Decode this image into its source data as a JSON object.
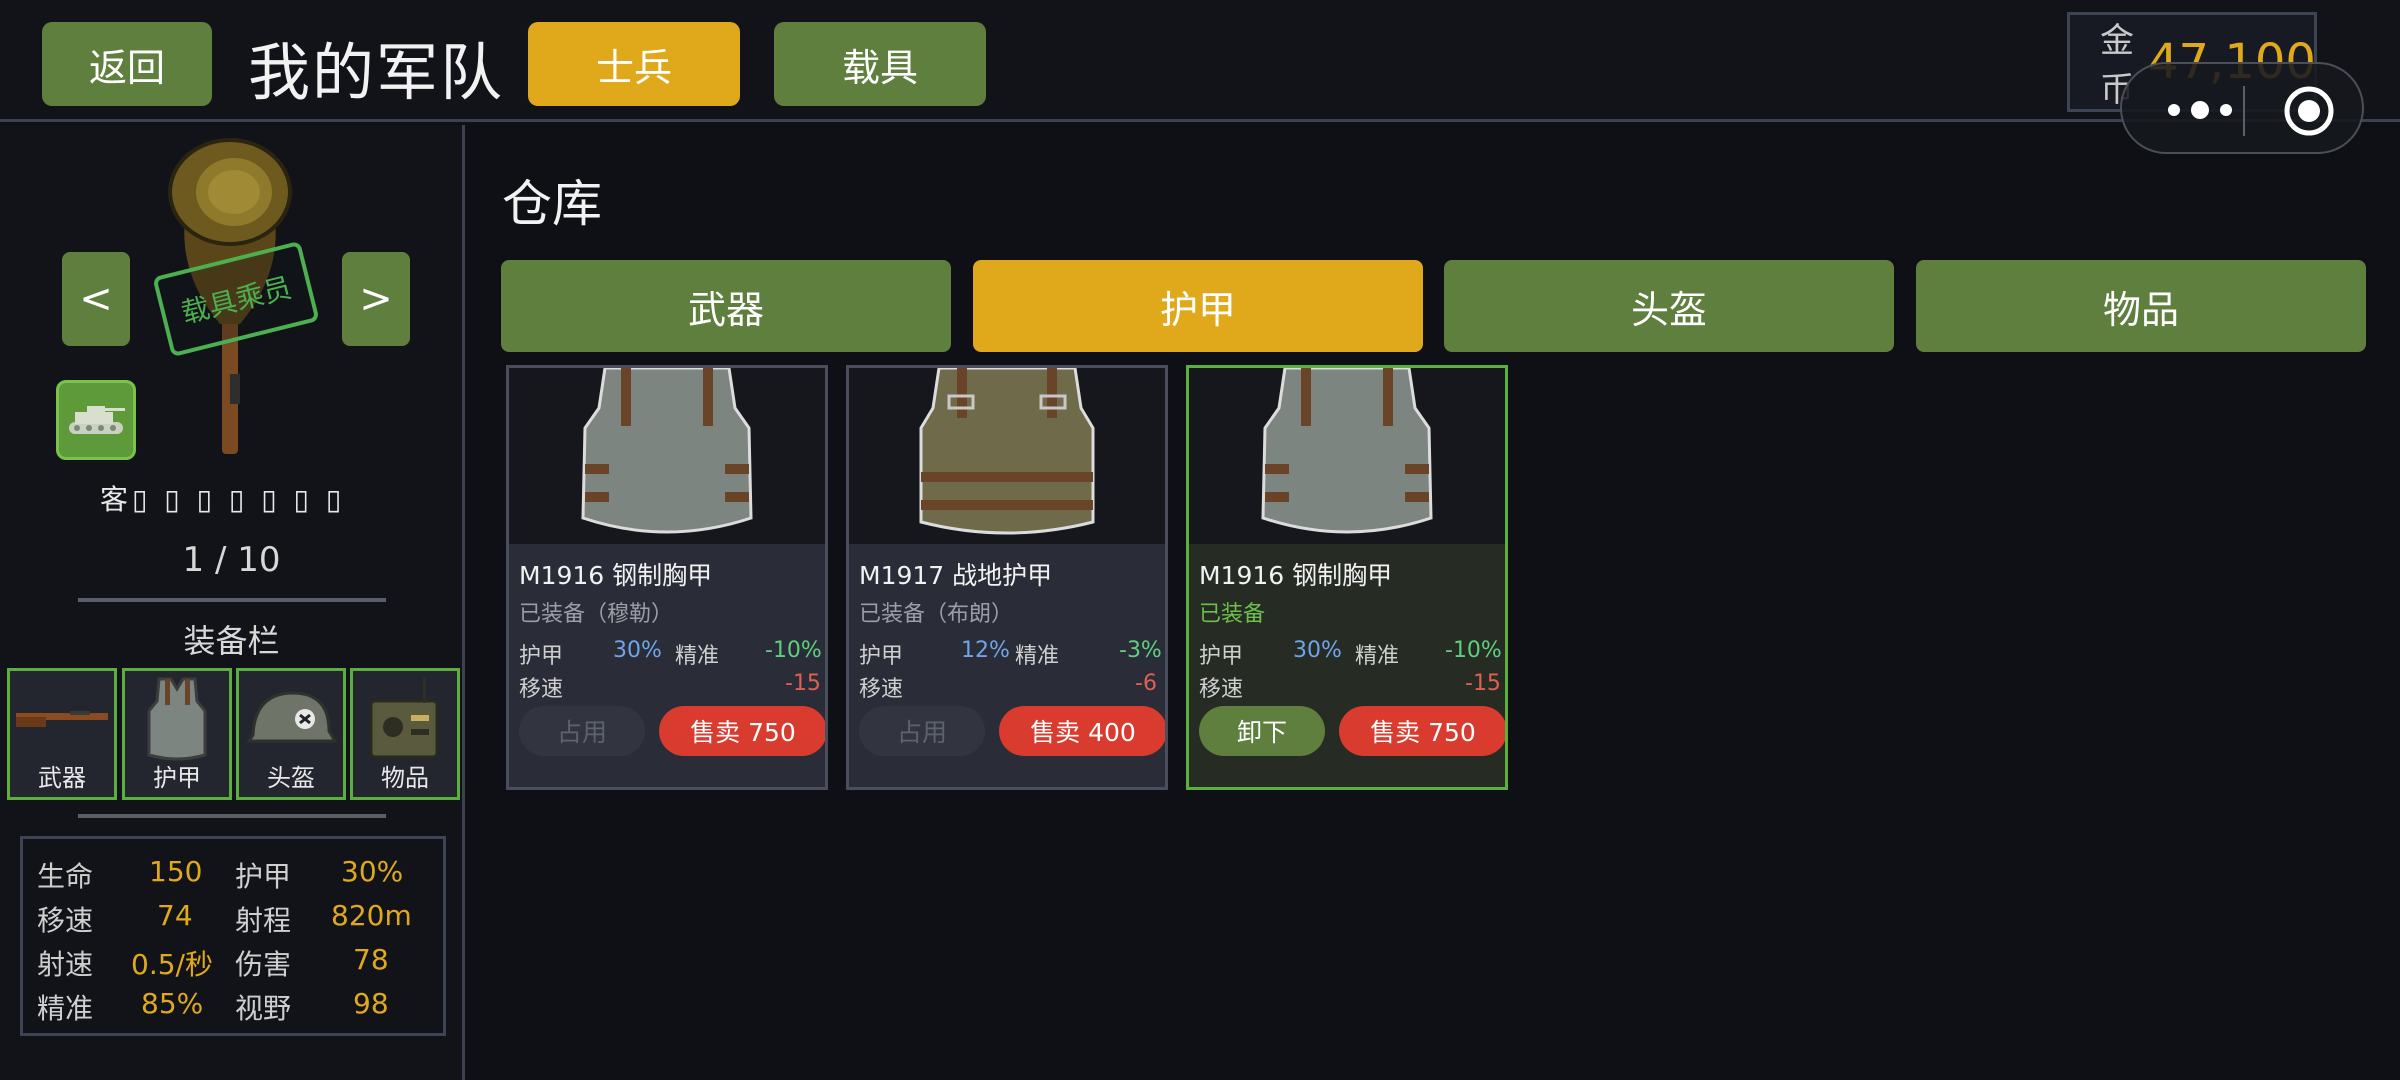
{
  "header": {
    "back_label": "返回",
    "title": "我的军队",
    "tabs": [
      {
        "label": "士兵",
        "active": true
      },
      {
        "label": "载具",
        "active": false
      }
    ],
    "coins": {
      "label": "金币",
      "value": "47,100"
    }
  },
  "unit": {
    "prev_label": "<",
    "next_label": ">",
    "stamp_label": "载具乘员",
    "garbled_name": "客▯ ▯ ▯ ▯ ▯ ▯ ▯",
    "counter": "1 / 10"
  },
  "equipment": {
    "title": "装备栏",
    "slots": [
      {
        "label": "武器",
        "icon": "rifle-icon"
      },
      {
        "label": "护甲",
        "icon": "vest-icon"
      },
      {
        "label": "头盔",
        "icon": "helmet-icon"
      },
      {
        "label": "物品",
        "icon": "radio-icon"
      }
    ]
  },
  "stats": [
    {
      "k1": "生命",
      "v1": "150",
      "k2": "护甲",
      "v2": "30%"
    },
    {
      "k1": "移速",
      "v1": "74",
      "k2": "射程",
      "v2": "820m"
    },
    {
      "k1": "射速",
      "v1": "0.5/秒",
      "k2": "伤害",
      "v2": "78"
    },
    {
      "k1": "精准",
      "v1": "85%",
      "k2": "视野",
      "v2": "98"
    }
  ],
  "warehouse": {
    "title": "仓库",
    "tabs": [
      {
        "label": "武器",
        "active": false
      },
      {
        "label": "护甲",
        "active": true
      },
      {
        "label": "头盔",
        "active": false
      },
      {
        "label": "物品",
        "active": false
      }
    ],
    "items": [
      {
        "name": "M1916 钢制胸甲",
        "status": "已装备（穆勒）",
        "armor_k": "护甲",
        "armor_v": "30%",
        "acc_k": "精准",
        "acc_v": "-10%",
        "speed_k": "移速",
        "speed_v": "-15",
        "left_btn": "占用",
        "sell_btn": "售卖 750",
        "equipped": false
      },
      {
        "name": "M1917 战地护甲",
        "status": "已装备（布朗）",
        "armor_k": "护甲",
        "armor_v": "12%",
        "acc_k": "精准",
        "acc_v": "-3%",
        "speed_k": "移速",
        "speed_v": "-6",
        "left_btn": "占用",
        "sell_btn": "售卖 400",
        "equipped": false
      },
      {
        "name": "M1916 钢制胸甲",
        "status": "已装备",
        "armor_k": "护甲",
        "armor_v": "30%",
        "acc_k": "精准",
        "acc_v": "-10%",
        "speed_k": "移速",
        "speed_v": "-15",
        "left_btn": "卸下",
        "sell_btn": "售卖 750",
        "equipped": true
      }
    ]
  },
  "colors": {
    "accent_green": "#5f7f3f",
    "accent_gold": "#e0a91c",
    "sell_red": "#d93b2f",
    "equipped_border": "#5cae3f"
  }
}
